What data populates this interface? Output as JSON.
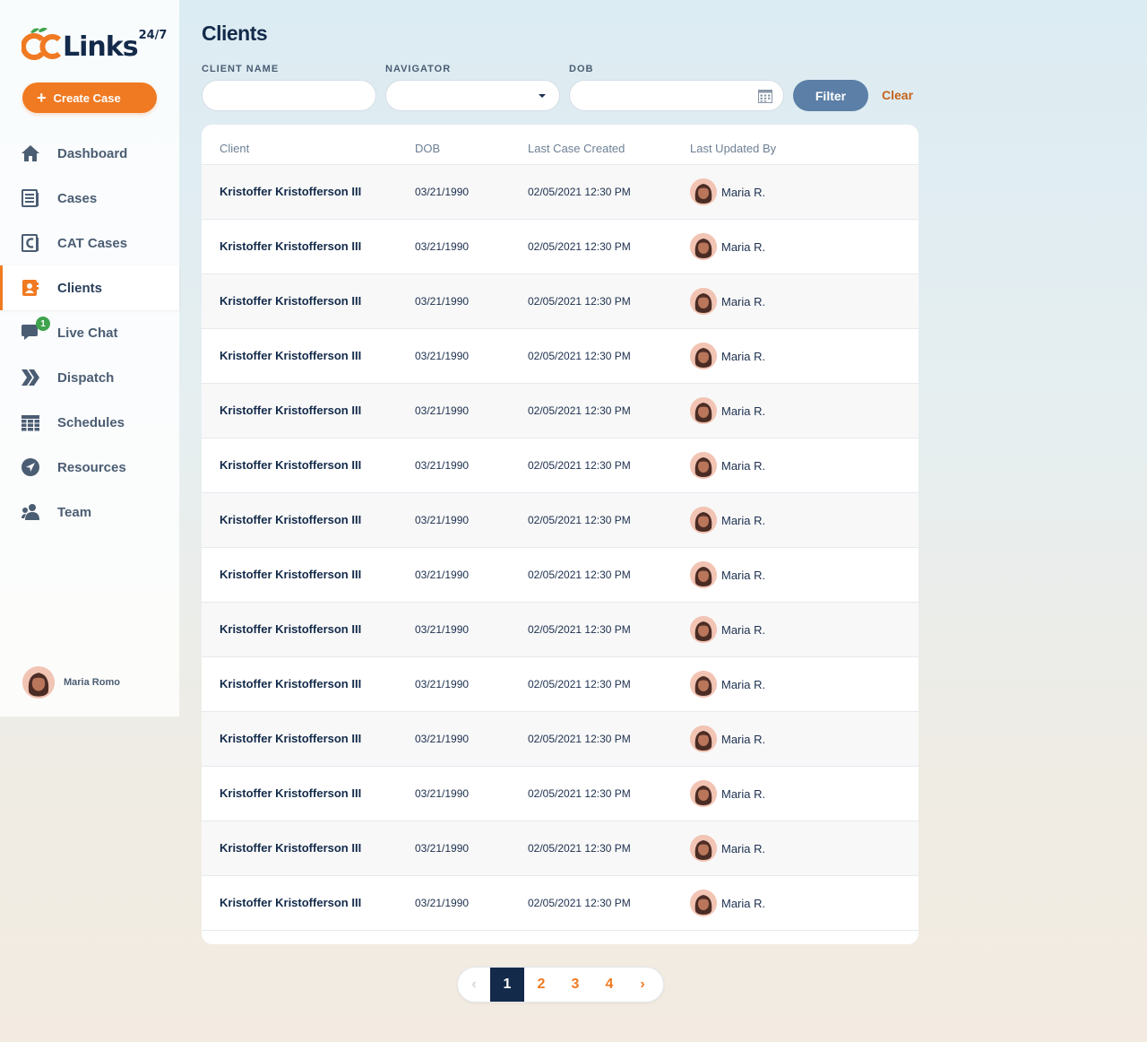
{
  "brand": {
    "name": "Links",
    "suffix": "24/7"
  },
  "sidebar": {
    "create_button": "Create Case",
    "items": [
      {
        "label": "Dashboard",
        "icon": "home-icon",
        "active": false
      },
      {
        "label": "Cases",
        "icon": "cases-icon",
        "active": false
      },
      {
        "label": "CAT Cases",
        "icon": "cat-cases-icon",
        "active": false
      },
      {
        "label": "Clients",
        "icon": "clients-icon",
        "active": true
      },
      {
        "label": "Live Chat",
        "icon": "chat-icon",
        "active": false,
        "badge": "1"
      },
      {
        "label": "Dispatch",
        "icon": "dispatch-icon",
        "active": false
      },
      {
        "label": "Schedules",
        "icon": "calendar-icon",
        "active": false
      },
      {
        "label": "Resources",
        "icon": "compass-icon",
        "active": false
      },
      {
        "label": "Team",
        "icon": "team-icon",
        "active": false
      }
    ],
    "user": {
      "name": "Maria Romo"
    }
  },
  "main": {
    "title": "Clients",
    "filters": {
      "client_name_label": "CLIENT NAME",
      "client_name_value": "",
      "navigator_label": "NAVIGATOR",
      "navigator_value": "",
      "dob_label": "DOB",
      "dob_value": "",
      "filter_button": "Filter",
      "clear_link": "Clear"
    },
    "table": {
      "headers": [
        "Client",
        "DOB",
        "Last Case Created",
        "Last Updated By"
      ],
      "rows": [
        {
          "client": "Kristoffer Kristofferson III",
          "dob": "03/21/1990",
          "last_case": "02/05/2021 12:30 PM",
          "updated_by": "Maria R."
        },
        {
          "client": "Kristoffer Kristofferson III",
          "dob": "03/21/1990",
          "last_case": "02/05/2021 12:30 PM",
          "updated_by": "Maria R."
        },
        {
          "client": "Kristoffer Kristofferson III",
          "dob": "03/21/1990",
          "last_case": "02/05/2021 12:30 PM",
          "updated_by": "Maria R."
        },
        {
          "client": "Kristoffer Kristofferson III",
          "dob": "03/21/1990",
          "last_case": "02/05/2021 12:30 PM",
          "updated_by": "Maria R."
        },
        {
          "client": "Kristoffer Kristofferson III",
          "dob": "03/21/1990",
          "last_case": "02/05/2021 12:30 PM",
          "updated_by": "Maria R."
        },
        {
          "client": "Kristoffer Kristofferson III",
          "dob": "03/21/1990",
          "last_case": "02/05/2021 12:30 PM",
          "updated_by": "Maria R."
        },
        {
          "client": "Kristoffer Kristofferson III",
          "dob": "03/21/1990",
          "last_case": "02/05/2021 12:30 PM",
          "updated_by": "Maria R."
        },
        {
          "client": "Kristoffer Kristofferson III",
          "dob": "03/21/1990",
          "last_case": "02/05/2021 12:30 PM",
          "updated_by": "Maria R."
        },
        {
          "client": "Kristoffer Kristofferson III",
          "dob": "03/21/1990",
          "last_case": "02/05/2021 12:30 PM",
          "updated_by": "Maria R."
        },
        {
          "client": "Kristoffer Kristofferson III",
          "dob": "03/21/1990",
          "last_case": "02/05/2021 12:30 PM",
          "updated_by": "Maria R."
        },
        {
          "client": "Kristoffer Kristofferson III",
          "dob": "03/21/1990",
          "last_case": "02/05/2021 12:30 PM",
          "updated_by": "Maria R."
        },
        {
          "client": "Kristoffer Kristofferson III",
          "dob": "03/21/1990",
          "last_case": "02/05/2021 12:30 PM",
          "updated_by": "Maria R."
        },
        {
          "client": "Kristoffer Kristofferson III",
          "dob": "03/21/1990",
          "last_case": "02/05/2021 12:30 PM",
          "updated_by": "Maria R."
        },
        {
          "client": "Kristoffer Kristofferson III",
          "dob": "03/21/1990",
          "last_case": "02/05/2021 12:30 PM",
          "updated_by": "Maria R."
        }
      ]
    },
    "pagination": {
      "pages": [
        "1",
        "2",
        "3",
        "4"
      ],
      "current": "1",
      "prev": "‹",
      "next": "›"
    }
  },
  "colors": {
    "accent": "#f07a22",
    "navy": "#132a4a",
    "filter_button": "#5b7fa6",
    "badge": "#3fa34d"
  }
}
